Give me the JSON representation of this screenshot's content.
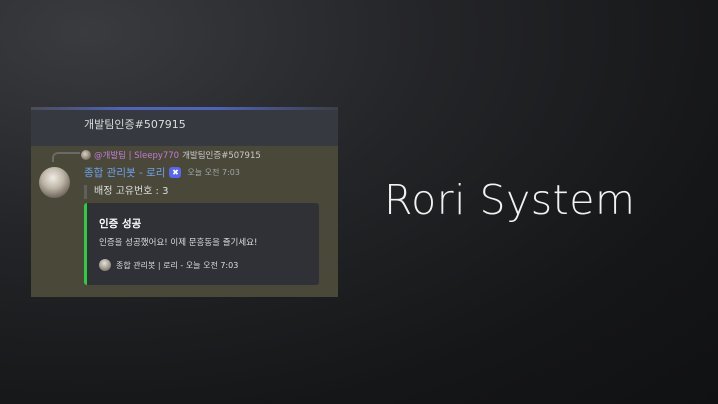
{
  "screenshot": {
    "previous_message": "개발팀인증#507915",
    "reply": {
      "user": "@개발팀 | Sleepy770",
      "text": "개발팀인증#507915"
    },
    "message": {
      "author": "종합 관리봇 - 로리",
      "badge": "✖",
      "timestamp": "오늘 오전 7:03",
      "field_text": "배정 고유번호 : 3"
    },
    "embed": {
      "accent_color": "#2ecc40",
      "title": "인증 성공",
      "description": "인증을 성공했어요! 이제 문흥동을 즐기세요!",
      "footer": "종합 관리봇 | 로리 - 오늘 오전 7:03"
    }
  },
  "headline": "Rori System"
}
